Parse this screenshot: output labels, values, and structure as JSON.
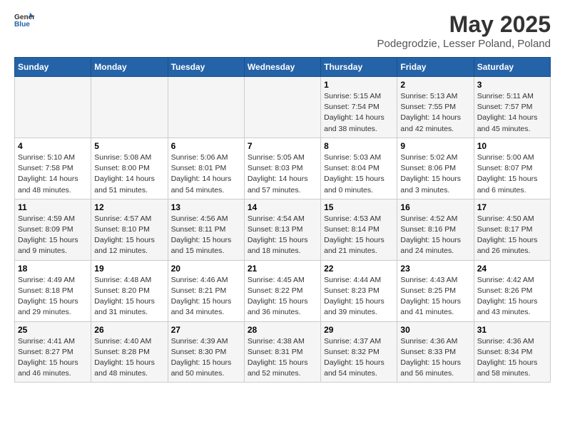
{
  "logo": {
    "general": "General",
    "blue": "Blue"
  },
  "header": {
    "title": "May 2025",
    "subtitle": "Podegrodzie, Lesser Poland, Poland"
  },
  "weekdays": [
    "Sunday",
    "Monday",
    "Tuesday",
    "Wednesday",
    "Thursday",
    "Friday",
    "Saturday"
  ],
  "weeks": [
    [
      {
        "day": "",
        "info": ""
      },
      {
        "day": "",
        "info": ""
      },
      {
        "day": "",
        "info": ""
      },
      {
        "day": "",
        "info": ""
      },
      {
        "day": "1",
        "info": "Sunrise: 5:15 AM\nSunset: 7:54 PM\nDaylight: 14 hours\nand 38 minutes."
      },
      {
        "day": "2",
        "info": "Sunrise: 5:13 AM\nSunset: 7:55 PM\nDaylight: 14 hours\nand 42 minutes."
      },
      {
        "day": "3",
        "info": "Sunrise: 5:11 AM\nSunset: 7:57 PM\nDaylight: 14 hours\nand 45 minutes."
      }
    ],
    [
      {
        "day": "4",
        "info": "Sunrise: 5:10 AM\nSunset: 7:58 PM\nDaylight: 14 hours\nand 48 minutes."
      },
      {
        "day": "5",
        "info": "Sunrise: 5:08 AM\nSunset: 8:00 PM\nDaylight: 14 hours\nand 51 minutes."
      },
      {
        "day": "6",
        "info": "Sunrise: 5:06 AM\nSunset: 8:01 PM\nDaylight: 14 hours\nand 54 minutes."
      },
      {
        "day": "7",
        "info": "Sunrise: 5:05 AM\nSunset: 8:03 PM\nDaylight: 14 hours\nand 57 minutes."
      },
      {
        "day": "8",
        "info": "Sunrise: 5:03 AM\nSunset: 8:04 PM\nDaylight: 15 hours\nand 0 minutes."
      },
      {
        "day": "9",
        "info": "Sunrise: 5:02 AM\nSunset: 8:06 PM\nDaylight: 15 hours\nand 3 minutes."
      },
      {
        "day": "10",
        "info": "Sunrise: 5:00 AM\nSunset: 8:07 PM\nDaylight: 15 hours\nand 6 minutes."
      }
    ],
    [
      {
        "day": "11",
        "info": "Sunrise: 4:59 AM\nSunset: 8:09 PM\nDaylight: 15 hours\nand 9 minutes."
      },
      {
        "day": "12",
        "info": "Sunrise: 4:57 AM\nSunset: 8:10 PM\nDaylight: 15 hours\nand 12 minutes."
      },
      {
        "day": "13",
        "info": "Sunrise: 4:56 AM\nSunset: 8:11 PM\nDaylight: 15 hours\nand 15 minutes."
      },
      {
        "day": "14",
        "info": "Sunrise: 4:54 AM\nSunset: 8:13 PM\nDaylight: 15 hours\nand 18 minutes."
      },
      {
        "day": "15",
        "info": "Sunrise: 4:53 AM\nSunset: 8:14 PM\nDaylight: 15 hours\nand 21 minutes."
      },
      {
        "day": "16",
        "info": "Sunrise: 4:52 AM\nSunset: 8:16 PM\nDaylight: 15 hours\nand 24 minutes."
      },
      {
        "day": "17",
        "info": "Sunrise: 4:50 AM\nSunset: 8:17 PM\nDaylight: 15 hours\nand 26 minutes."
      }
    ],
    [
      {
        "day": "18",
        "info": "Sunrise: 4:49 AM\nSunset: 8:18 PM\nDaylight: 15 hours\nand 29 minutes."
      },
      {
        "day": "19",
        "info": "Sunrise: 4:48 AM\nSunset: 8:20 PM\nDaylight: 15 hours\nand 31 minutes."
      },
      {
        "day": "20",
        "info": "Sunrise: 4:46 AM\nSunset: 8:21 PM\nDaylight: 15 hours\nand 34 minutes."
      },
      {
        "day": "21",
        "info": "Sunrise: 4:45 AM\nSunset: 8:22 PM\nDaylight: 15 hours\nand 36 minutes."
      },
      {
        "day": "22",
        "info": "Sunrise: 4:44 AM\nSunset: 8:23 PM\nDaylight: 15 hours\nand 39 minutes."
      },
      {
        "day": "23",
        "info": "Sunrise: 4:43 AM\nSunset: 8:25 PM\nDaylight: 15 hours\nand 41 minutes."
      },
      {
        "day": "24",
        "info": "Sunrise: 4:42 AM\nSunset: 8:26 PM\nDaylight: 15 hours\nand 43 minutes."
      }
    ],
    [
      {
        "day": "25",
        "info": "Sunrise: 4:41 AM\nSunset: 8:27 PM\nDaylight: 15 hours\nand 46 minutes."
      },
      {
        "day": "26",
        "info": "Sunrise: 4:40 AM\nSunset: 8:28 PM\nDaylight: 15 hours\nand 48 minutes."
      },
      {
        "day": "27",
        "info": "Sunrise: 4:39 AM\nSunset: 8:30 PM\nDaylight: 15 hours\nand 50 minutes."
      },
      {
        "day": "28",
        "info": "Sunrise: 4:38 AM\nSunset: 8:31 PM\nDaylight: 15 hours\nand 52 minutes."
      },
      {
        "day": "29",
        "info": "Sunrise: 4:37 AM\nSunset: 8:32 PM\nDaylight: 15 hours\nand 54 minutes."
      },
      {
        "day": "30",
        "info": "Sunrise: 4:36 AM\nSunset: 8:33 PM\nDaylight: 15 hours\nand 56 minutes."
      },
      {
        "day": "31",
        "info": "Sunrise: 4:36 AM\nSunset: 8:34 PM\nDaylight: 15 hours\nand 58 minutes."
      }
    ]
  ]
}
